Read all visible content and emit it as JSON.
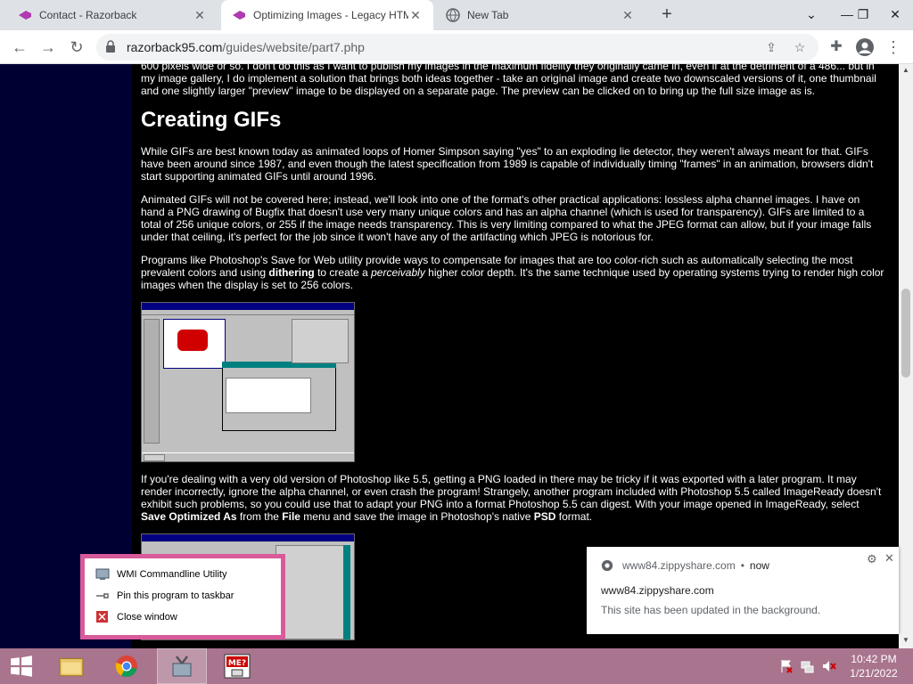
{
  "tabs": [
    {
      "title": "Contact - Razorback"
    },
    {
      "title": "Optimizing Images - Legacy HTML T"
    },
    {
      "title": "New Tab"
    }
  ],
  "omnibox": {
    "domain": "razorback95.com",
    "path": "/guides/website/part7.php"
  },
  "article": {
    "intro_tail": "600 pixels wide or so. I don't do this as I want to publish my images in the maximum fidelity they originally came in, even if at the detriment of a 486... but in my image gallery, I do implement a solution that brings both ideas together - take an original image and create two downscaled versions of it, one thumbnail and one slightly larger \"preview\" image to be displayed on a separate page. The preview can be clicked on to bring up the full size image as is.",
    "heading": "Creating GIFs",
    "p1": "While GIFs are best known today as animated loops of Homer Simpson saying \"yes\" to an exploding lie detector, they weren't always meant for that. GIFs have been around since 1987, and even though the latest specification from 1989 is capable of individually timing \"frames\" in an animation, browsers didn't start supporting animated GIFs until around 1996.",
    "p2": "Animated GIFs will not be covered here; instead, we'll look into one of the format's other practical applications: lossless alpha channel images. I have on hand a PNG drawing of Bugfix that doesn't use very many unique colors and has an alpha channel (which is used for transparency). GIFs are limited to a total of 256 unique colors, or 255 if the image needs transparency. This is very limiting compared to what the JPEG format can allow, but if your image falls under that ceiling, it's perfect for the job since it won't have any of the artifacting which JPEG is notorious for.",
    "p3_a": "Programs like Photoshop's Save for Web utility provide ways to compensate for images that are too color-rich such as automatically selecting the most prevalent colors and using ",
    "p3_b": "dithering",
    "p3_c": " to create a ",
    "p3_d": "perceivably",
    "p3_e": " higher color depth. It's the same technique used by operating systems trying to render high color images when the display is set to 256 colors.",
    "p4_a": "If you're dealing with a very old version of Photoshop like 5.5, getting a PNG loaded in there may be tricky if it was exported with a later program. It may render incorrectly, ignore the alpha channel, or even crash the program! Strangely, another program included with Photoshop 5.5 called ImageReady doesn't exhibit such problems, so you could use that to adapt your PNG into a format Photoshop 5.5 can digest. With your image opened in ImageReady, select ",
    "p4_b": "Save Optimized As",
    "p4_c": " from the ",
    "p4_d": "File",
    "p4_e": " menu and save the image in Photoshop's native ",
    "p4_f": "PSD",
    "p4_g": " format."
  },
  "jumplist": {
    "items": [
      "WMI Commandline Utility",
      "Pin this program to taskbar",
      "Close window"
    ]
  },
  "notification": {
    "source": "www84.zippyshare.com",
    "time": "now",
    "origin": "www84.zippyshare.com",
    "message": "This site has been updated in the background."
  },
  "clock": {
    "time": "10:42 PM",
    "date": "1/21/2022"
  },
  "colors": {
    "taskbar": "#a8748e",
    "jumplist_border": "#d85a9a",
    "page_band": "#000033"
  }
}
